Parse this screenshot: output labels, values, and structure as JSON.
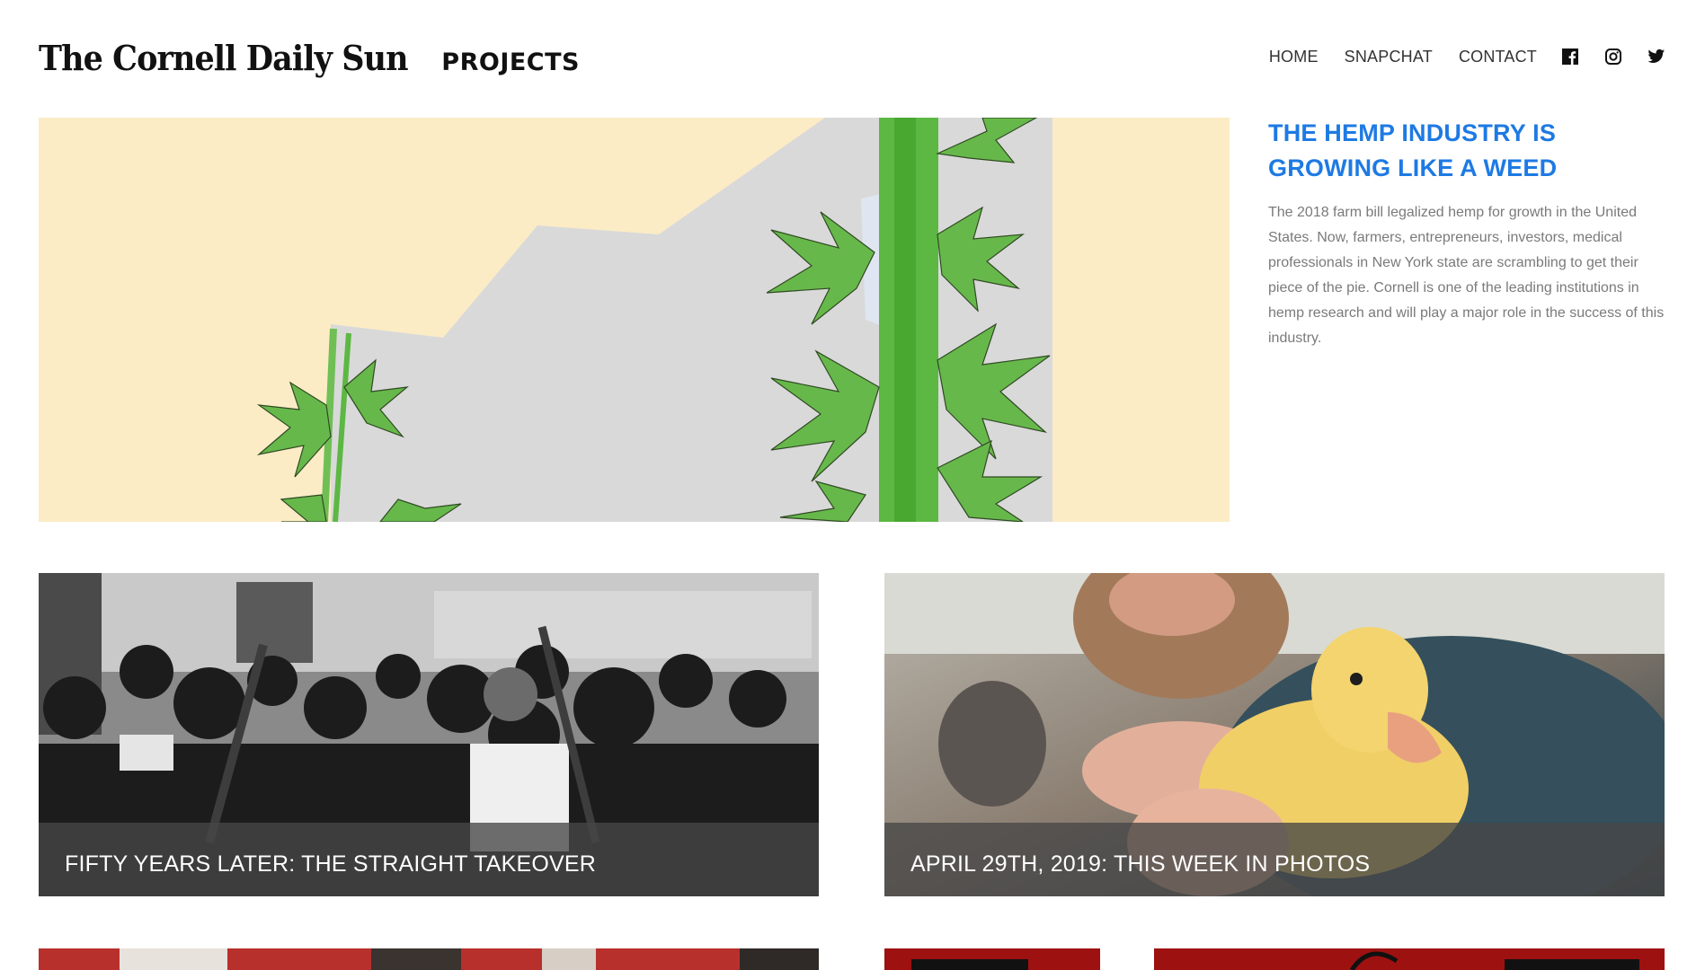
{
  "header": {
    "logo_text": "The Cornell Daily Sun",
    "section_label": "PROJECTS",
    "nav": [
      {
        "label": "HOME"
      },
      {
        "label": "SNAPCHAT"
      },
      {
        "label": "CONTACT"
      }
    ],
    "social_icons": [
      "facebook-icon",
      "instagram-icon",
      "twitter-icon"
    ]
  },
  "featured": {
    "title": "THE HEMP INDUSTRY IS GROWING LIKE A WEED",
    "description": "The 2018 farm bill legalized hemp for growth in the United States. Now, farmers, entrepreneurs, investors, medical professionals in New York state are scrambling to get their piece of the pie. Cornell is one of the leading institutions in hemp research and will play a major role in the success of this industry."
  },
  "cards": [
    {
      "title": "FIFTY YEARS LATER: THE STRAIGHT TAKEOVER"
    },
    {
      "title": "APRIL 29TH, 2019: THIS WEEK IN PHOTOS"
    }
  ],
  "colors": {
    "accent": "#1e7ae3",
    "hero_bg": "#fbecc6",
    "caption_overlay": "#464646"
  }
}
